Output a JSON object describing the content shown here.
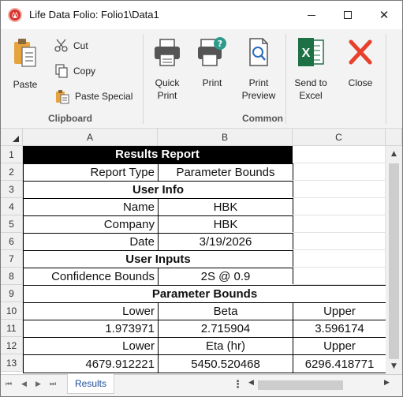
{
  "window": {
    "title": "Life Data Folio: Folio1\\Data1",
    "controls": {
      "minimize": "",
      "maximize": "",
      "close": "✕"
    }
  },
  "ribbon": {
    "clipboard": {
      "group_label": "Clipboard",
      "paste": "Paste",
      "cut": "Cut",
      "copy": "Copy",
      "paste_special": "Paste Special"
    },
    "common": {
      "group_label": "Common",
      "quick_print": "Quick\nPrint",
      "print": "Print",
      "print_preview": "Print\nPreview",
      "send_to_excel": "Send to\nExcel",
      "close": "Close"
    }
  },
  "grid": {
    "columns": [
      "A",
      "B",
      "C"
    ],
    "rows": [
      "1",
      "2",
      "3",
      "4",
      "5",
      "6",
      "7",
      "8",
      "9",
      "10",
      "11",
      "12",
      "13"
    ],
    "cells": {
      "r1": "Results Report",
      "r2a": "Report Type",
      "r2b": "Parameter Bounds",
      "r3": "User Info",
      "r4a": "Name",
      "r4b": "HBK",
      "r5a": "Company",
      "r5b": "HBK",
      "r6a": "Date",
      "r6b": "3/19/2026",
      "r7": "User Inputs",
      "r8a": "Confidence Bounds",
      "r8b": "2S @ 0.9",
      "r9": "Parameter Bounds",
      "r10a": "Lower",
      "r10b": "Beta",
      "r10c": "Upper",
      "r11a": "1.973971",
      "r11b": "2.715904",
      "r11c": "3.596174",
      "r12a": "Lower",
      "r12b": "Eta (hr)",
      "r12c": "Upper",
      "r13a": "4679.912221",
      "r13b": "5450.520468",
      "r13c": "6296.418771"
    }
  },
  "sheet_tabs": {
    "active": "Results",
    "more": "⋮"
  },
  "colors": {
    "accent": "#d9332c",
    "excel_green": "#1e7145",
    "close_red": "#e8402b",
    "tab_text": "#1f4e9b"
  }
}
